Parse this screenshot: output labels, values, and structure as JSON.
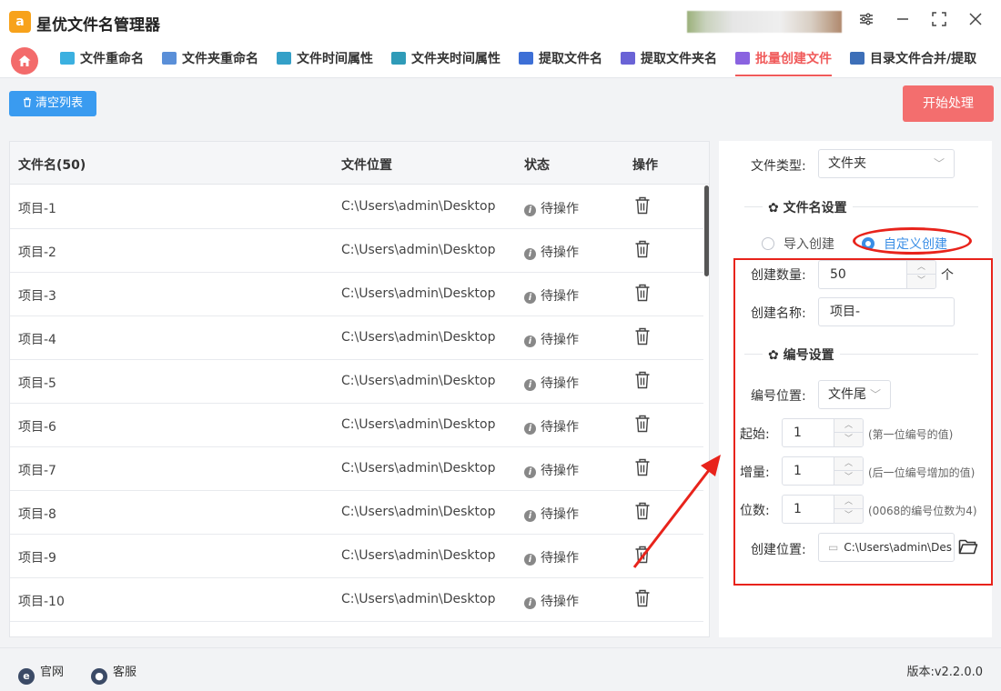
{
  "app": {
    "title": "星优文件名管理器",
    "logo_letter": "a"
  },
  "nav": {
    "tabs": [
      {
        "label": "文件重命名",
        "color": "#3bb0e0"
      },
      {
        "label": "文件夹重命名",
        "color": "#5a8fd8"
      },
      {
        "label": "文件时间属性",
        "color": "#34a0c8"
      },
      {
        "label": "文件夹时间属性",
        "color": "#2f9bb8"
      },
      {
        "label": "提取文件名",
        "color": "#3d6fd6"
      },
      {
        "label": "提取文件夹名",
        "color": "#6a63d6"
      },
      {
        "label": "批量创建文件",
        "color": "#8a63e0"
      },
      {
        "label": "目录文件合并/提取",
        "color": "#3d6fb8"
      }
    ],
    "active_index": 6
  },
  "toolbar": {
    "clear_label": "清空列表",
    "start_label": "开始处理"
  },
  "table": {
    "headers": [
      "文件名(50)",
      "文件位置",
      "状态",
      "操作"
    ],
    "rows": [
      {
        "name": "项目-1",
        "path": "C:\\Users\\admin\\Desktop",
        "status": "待操作"
      },
      {
        "name": "项目-2",
        "path": "C:\\Users\\admin\\Desktop",
        "status": "待操作"
      },
      {
        "name": "项目-3",
        "path": "C:\\Users\\admin\\Desktop",
        "status": "待操作"
      },
      {
        "name": "项目-4",
        "path": "C:\\Users\\admin\\Desktop",
        "status": "待操作"
      },
      {
        "name": "项目-5",
        "path": "C:\\Users\\admin\\Desktop",
        "status": "待操作"
      },
      {
        "name": "项目-6",
        "path": "C:\\Users\\admin\\Desktop",
        "status": "待操作"
      },
      {
        "name": "项目-7",
        "path": "C:\\Users\\admin\\Desktop",
        "status": "待操作"
      },
      {
        "name": "项目-8",
        "path": "C:\\Users\\admin\\Desktop",
        "status": "待操作"
      },
      {
        "name": "项目-9",
        "path": "C:\\Users\\admin\\Desktop",
        "status": "待操作"
      },
      {
        "name": "项目-10",
        "path": "C:\\Users\\admin\\Desktop",
        "status": "待操作"
      }
    ]
  },
  "panel": {
    "file_type_label": "文件类型:",
    "file_type_value": "文件夹",
    "filename_section": "文件名设置",
    "radio_import": "导入创建",
    "radio_custom": "自定义创建",
    "count_label": "创建数量:",
    "count_value": "50",
    "count_unit": "个",
    "name_label": "创建名称:",
    "name_value": "项目-",
    "numbering_section": "编号设置",
    "num_pos_label": "编号位置:",
    "num_pos_value": "文件尾",
    "start_label": "起始:",
    "start_value": "1",
    "start_hint": "(第一位编号的值)",
    "step_label": "增量:",
    "step_value": "1",
    "step_hint": "(后一位编号增加的值)",
    "digits_label": "位数:",
    "digits_value": "1",
    "digits_hint": "(0068的编号位数为4)",
    "location_label": "创建位置:",
    "location_value": "C:\\Users\\admin\\Des"
  },
  "footer": {
    "website": "官网",
    "support": "客服",
    "version": "版本:v2.2.0.0"
  },
  "colors": {
    "accent_red": "#f36e6e",
    "accent_blue": "#3a9bf0",
    "annotation_red": "#e8231b"
  }
}
